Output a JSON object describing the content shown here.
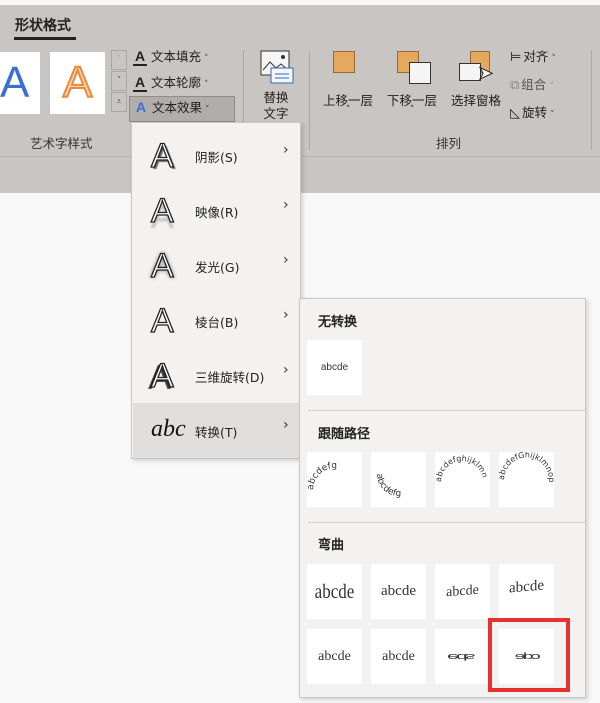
{
  "ribbon": {
    "tab": "形状格式",
    "wordart_group": {
      "label": "艺术字样式",
      "preview_letter": "A",
      "buttons": [
        {
          "icon": "A",
          "label": "文本填充"
        },
        {
          "icon": "A",
          "label": "文本轮廓"
        },
        {
          "icon": "A",
          "label": "文本效果"
        }
      ]
    },
    "alt_text": {
      "label_line1": "替换",
      "label_line2": "文字"
    },
    "arrange_group": {
      "label": "排列",
      "buttons": [
        {
          "label": "上移一层"
        },
        {
          "label": "下移一层"
        },
        {
          "label": "选择窗格"
        }
      ],
      "small_buttons": [
        {
          "label": "对齐"
        },
        {
          "label": "组合",
          "disabled": true
        },
        {
          "label": "旋转"
        }
      ]
    },
    "colors": {
      "ribbon_bg": "#c8c5c2",
      "accent_orange": "#e4a85e",
      "preview_blue": "#3b6fd4"
    }
  },
  "effects_menu": {
    "items": [
      {
        "icon": "shadow-A",
        "label": "阴影(S)",
        "key": "S"
      },
      {
        "icon": "reflection-A",
        "label": "映像(R)",
        "key": "R"
      },
      {
        "icon": "glow-A",
        "label": "发光(G)",
        "key": "G"
      },
      {
        "icon": "bevel-A",
        "label": "棱台(B)",
        "key": "B"
      },
      {
        "icon": "3d-rotation-A",
        "label": "三维旋转(D)",
        "key": "D"
      },
      {
        "icon": "transform-abc",
        "icon_text": "abc",
        "label": "转换(T)",
        "key": "T",
        "selected": true
      }
    ]
  },
  "transform_menu": {
    "no_transform": {
      "header": "无转换",
      "tile_text": "abcde"
    },
    "follow_path": {
      "header": "跟随路径",
      "tiles": [
        "abcdefg",
        "abcdefg",
        "abcdefghijklmn",
        "abcdefGhijklmnop"
      ]
    },
    "warp": {
      "header": "弯曲",
      "tile_text": "abcde",
      "tiles": 8,
      "highlighted_index": 7,
      "highlight_color": "#e8312f"
    }
  }
}
